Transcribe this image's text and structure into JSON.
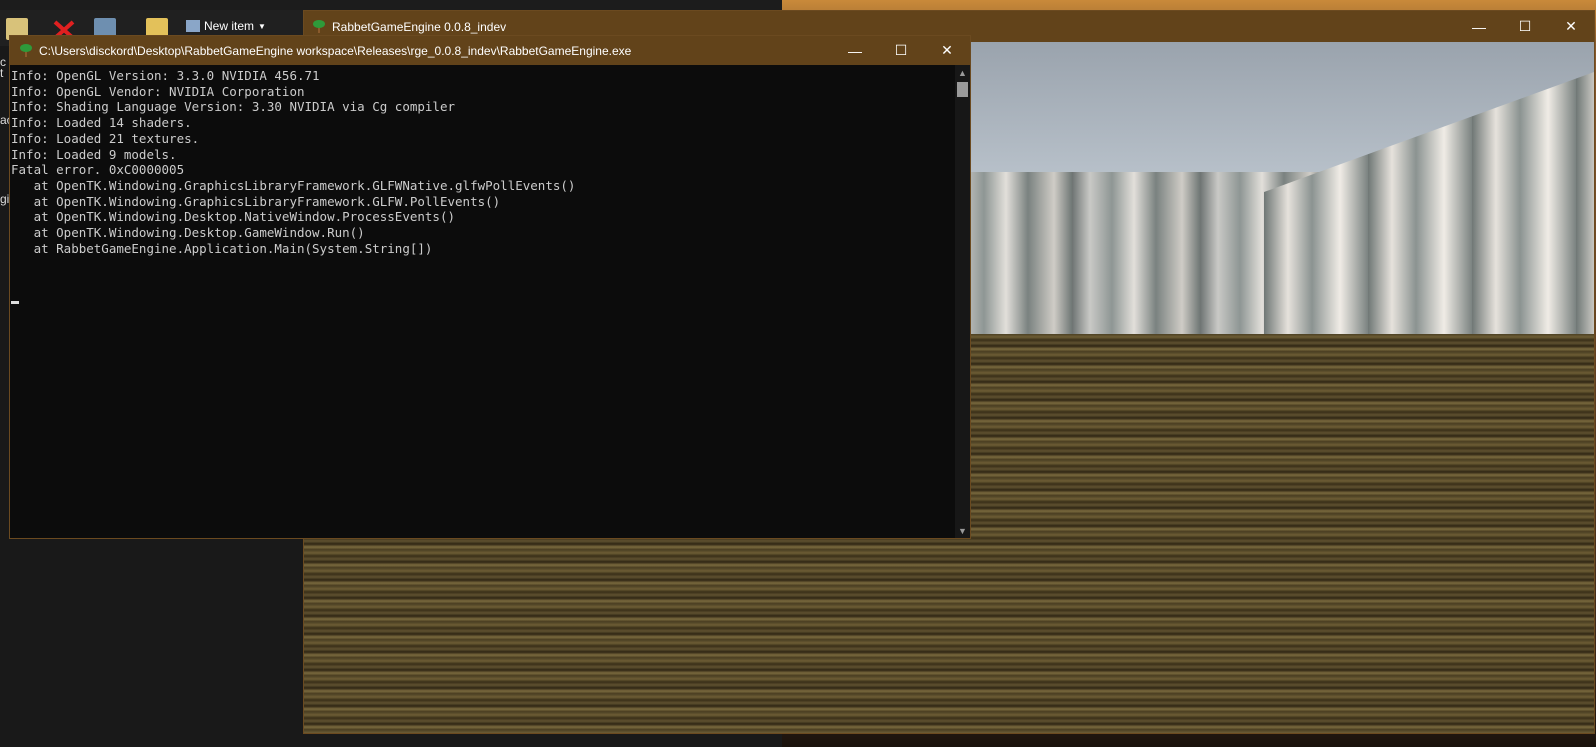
{
  "explorer": {
    "new_item_label": "New item",
    "side_labels": [
      "t",
      "c",
      "gi",
      "ac"
    ]
  },
  "game_window": {
    "title": "RabbetGameEngine 0.0.8_indev",
    "minimize": "—",
    "maximize": "☐",
    "close": "✕"
  },
  "console_window": {
    "title": "C:\\Users\\disckord\\Desktop\\RabbetGameEngine workspace\\Releases\\rge_0.0.8_indev\\RabbetGameEngine.exe",
    "minimize": "—",
    "maximize": "☐",
    "close": "✕",
    "lines": [
      "Info: OpenGL Version: 3.3.0 NVIDIA 456.71",
      "Info: OpenGL Vendor: NVIDIA Corporation",
      "Info: Shading Language Version: 3.30 NVIDIA via Cg compiler",
      "Info: Loaded 14 shaders.",
      "Info: Loaded 21 textures.",
      "Info: Loaded 9 models.",
      "Fatal error. 0xC0000005",
      "   at OpenTK.Windowing.GraphicsLibraryFramework.GLFWNative.glfwPollEvents()",
      "   at OpenTK.Windowing.GraphicsLibraryFramework.GLFW.PollEvents()",
      "   at OpenTK.Windowing.Desktop.NativeWindow.ProcessEvents()",
      "   at OpenTK.Windowing.Desktop.GameWindow.Run()",
      "   at RabbetGameEngine.Application.Main(System.String[])"
    ],
    "scroll_up": "▲",
    "scroll_down": "▼"
  },
  "colors": {
    "titlebar": "#62431a",
    "console_bg": "#0c0c0c",
    "console_text": "#cccccc"
  }
}
